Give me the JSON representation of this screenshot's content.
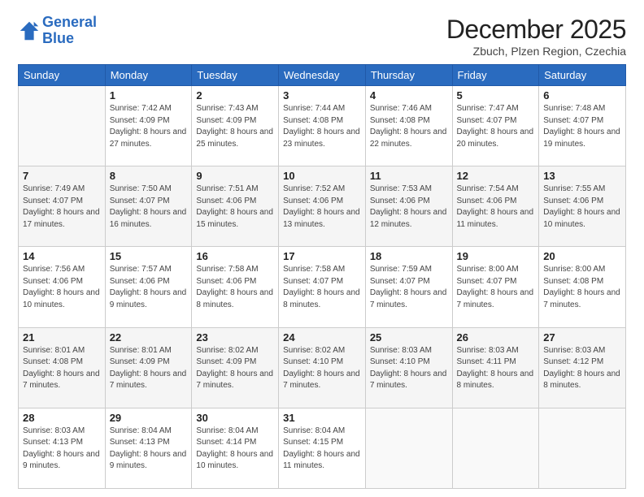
{
  "header": {
    "logo_line1": "General",
    "logo_line2": "Blue",
    "month_year": "December 2025",
    "location": "Zbuch, Plzen Region, Czechia"
  },
  "weekdays": [
    "Sunday",
    "Monday",
    "Tuesday",
    "Wednesday",
    "Thursday",
    "Friday",
    "Saturday"
  ],
  "weeks": [
    [
      {
        "day": "",
        "sunrise": "",
        "sunset": "",
        "daylight": ""
      },
      {
        "day": "1",
        "sunrise": "Sunrise: 7:42 AM",
        "sunset": "Sunset: 4:09 PM",
        "daylight": "Daylight: 8 hours and 27 minutes."
      },
      {
        "day": "2",
        "sunrise": "Sunrise: 7:43 AM",
        "sunset": "Sunset: 4:09 PM",
        "daylight": "Daylight: 8 hours and 25 minutes."
      },
      {
        "day": "3",
        "sunrise": "Sunrise: 7:44 AM",
        "sunset": "Sunset: 4:08 PM",
        "daylight": "Daylight: 8 hours and 23 minutes."
      },
      {
        "day": "4",
        "sunrise": "Sunrise: 7:46 AM",
        "sunset": "Sunset: 4:08 PM",
        "daylight": "Daylight: 8 hours and 22 minutes."
      },
      {
        "day": "5",
        "sunrise": "Sunrise: 7:47 AM",
        "sunset": "Sunset: 4:07 PM",
        "daylight": "Daylight: 8 hours and 20 minutes."
      },
      {
        "day": "6",
        "sunrise": "Sunrise: 7:48 AM",
        "sunset": "Sunset: 4:07 PM",
        "daylight": "Daylight: 8 hours and 19 minutes."
      }
    ],
    [
      {
        "day": "7",
        "sunrise": "Sunrise: 7:49 AM",
        "sunset": "Sunset: 4:07 PM",
        "daylight": "Daylight: 8 hours and 17 minutes."
      },
      {
        "day": "8",
        "sunrise": "Sunrise: 7:50 AM",
        "sunset": "Sunset: 4:07 PM",
        "daylight": "Daylight: 8 hours and 16 minutes."
      },
      {
        "day": "9",
        "sunrise": "Sunrise: 7:51 AM",
        "sunset": "Sunset: 4:06 PM",
        "daylight": "Daylight: 8 hours and 15 minutes."
      },
      {
        "day": "10",
        "sunrise": "Sunrise: 7:52 AM",
        "sunset": "Sunset: 4:06 PM",
        "daylight": "Daylight: 8 hours and 13 minutes."
      },
      {
        "day": "11",
        "sunrise": "Sunrise: 7:53 AM",
        "sunset": "Sunset: 4:06 PM",
        "daylight": "Daylight: 8 hours and 12 minutes."
      },
      {
        "day": "12",
        "sunrise": "Sunrise: 7:54 AM",
        "sunset": "Sunset: 4:06 PM",
        "daylight": "Daylight: 8 hours and 11 minutes."
      },
      {
        "day": "13",
        "sunrise": "Sunrise: 7:55 AM",
        "sunset": "Sunset: 4:06 PM",
        "daylight": "Daylight: 8 hours and 10 minutes."
      }
    ],
    [
      {
        "day": "14",
        "sunrise": "Sunrise: 7:56 AM",
        "sunset": "Sunset: 4:06 PM",
        "daylight": "Daylight: 8 hours and 10 minutes."
      },
      {
        "day": "15",
        "sunrise": "Sunrise: 7:57 AM",
        "sunset": "Sunset: 4:06 PM",
        "daylight": "Daylight: 8 hours and 9 minutes."
      },
      {
        "day": "16",
        "sunrise": "Sunrise: 7:58 AM",
        "sunset": "Sunset: 4:06 PM",
        "daylight": "Daylight: 8 hours and 8 minutes."
      },
      {
        "day": "17",
        "sunrise": "Sunrise: 7:58 AM",
        "sunset": "Sunset: 4:07 PM",
        "daylight": "Daylight: 8 hours and 8 minutes."
      },
      {
        "day": "18",
        "sunrise": "Sunrise: 7:59 AM",
        "sunset": "Sunset: 4:07 PM",
        "daylight": "Daylight: 8 hours and 7 minutes."
      },
      {
        "day": "19",
        "sunrise": "Sunrise: 8:00 AM",
        "sunset": "Sunset: 4:07 PM",
        "daylight": "Daylight: 8 hours and 7 minutes."
      },
      {
        "day": "20",
        "sunrise": "Sunrise: 8:00 AM",
        "sunset": "Sunset: 4:08 PM",
        "daylight": "Daylight: 8 hours and 7 minutes."
      }
    ],
    [
      {
        "day": "21",
        "sunrise": "Sunrise: 8:01 AM",
        "sunset": "Sunset: 4:08 PM",
        "daylight": "Daylight: 8 hours and 7 minutes."
      },
      {
        "day": "22",
        "sunrise": "Sunrise: 8:01 AM",
        "sunset": "Sunset: 4:09 PM",
        "daylight": "Daylight: 8 hours and 7 minutes."
      },
      {
        "day": "23",
        "sunrise": "Sunrise: 8:02 AM",
        "sunset": "Sunset: 4:09 PM",
        "daylight": "Daylight: 8 hours and 7 minutes."
      },
      {
        "day": "24",
        "sunrise": "Sunrise: 8:02 AM",
        "sunset": "Sunset: 4:10 PM",
        "daylight": "Daylight: 8 hours and 7 minutes."
      },
      {
        "day": "25",
        "sunrise": "Sunrise: 8:03 AM",
        "sunset": "Sunset: 4:10 PM",
        "daylight": "Daylight: 8 hours and 7 minutes."
      },
      {
        "day": "26",
        "sunrise": "Sunrise: 8:03 AM",
        "sunset": "Sunset: 4:11 PM",
        "daylight": "Daylight: 8 hours and 8 minutes."
      },
      {
        "day": "27",
        "sunrise": "Sunrise: 8:03 AM",
        "sunset": "Sunset: 4:12 PM",
        "daylight": "Daylight: 8 hours and 8 minutes."
      }
    ],
    [
      {
        "day": "28",
        "sunrise": "Sunrise: 8:03 AM",
        "sunset": "Sunset: 4:13 PM",
        "daylight": "Daylight: 8 hours and 9 minutes."
      },
      {
        "day": "29",
        "sunrise": "Sunrise: 8:04 AM",
        "sunset": "Sunset: 4:13 PM",
        "daylight": "Daylight: 8 hours and 9 minutes."
      },
      {
        "day": "30",
        "sunrise": "Sunrise: 8:04 AM",
        "sunset": "Sunset: 4:14 PM",
        "daylight": "Daylight: 8 hours and 10 minutes."
      },
      {
        "day": "31",
        "sunrise": "Sunrise: 8:04 AM",
        "sunset": "Sunset: 4:15 PM",
        "daylight": "Daylight: 8 hours and 11 minutes."
      },
      {
        "day": "",
        "sunrise": "",
        "sunset": "",
        "daylight": ""
      },
      {
        "day": "",
        "sunrise": "",
        "sunset": "",
        "daylight": ""
      },
      {
        "day": "",
        "sunrise": "",
        "sunset": "",
        "daylight": ""
      }
    ]
  ]
}
